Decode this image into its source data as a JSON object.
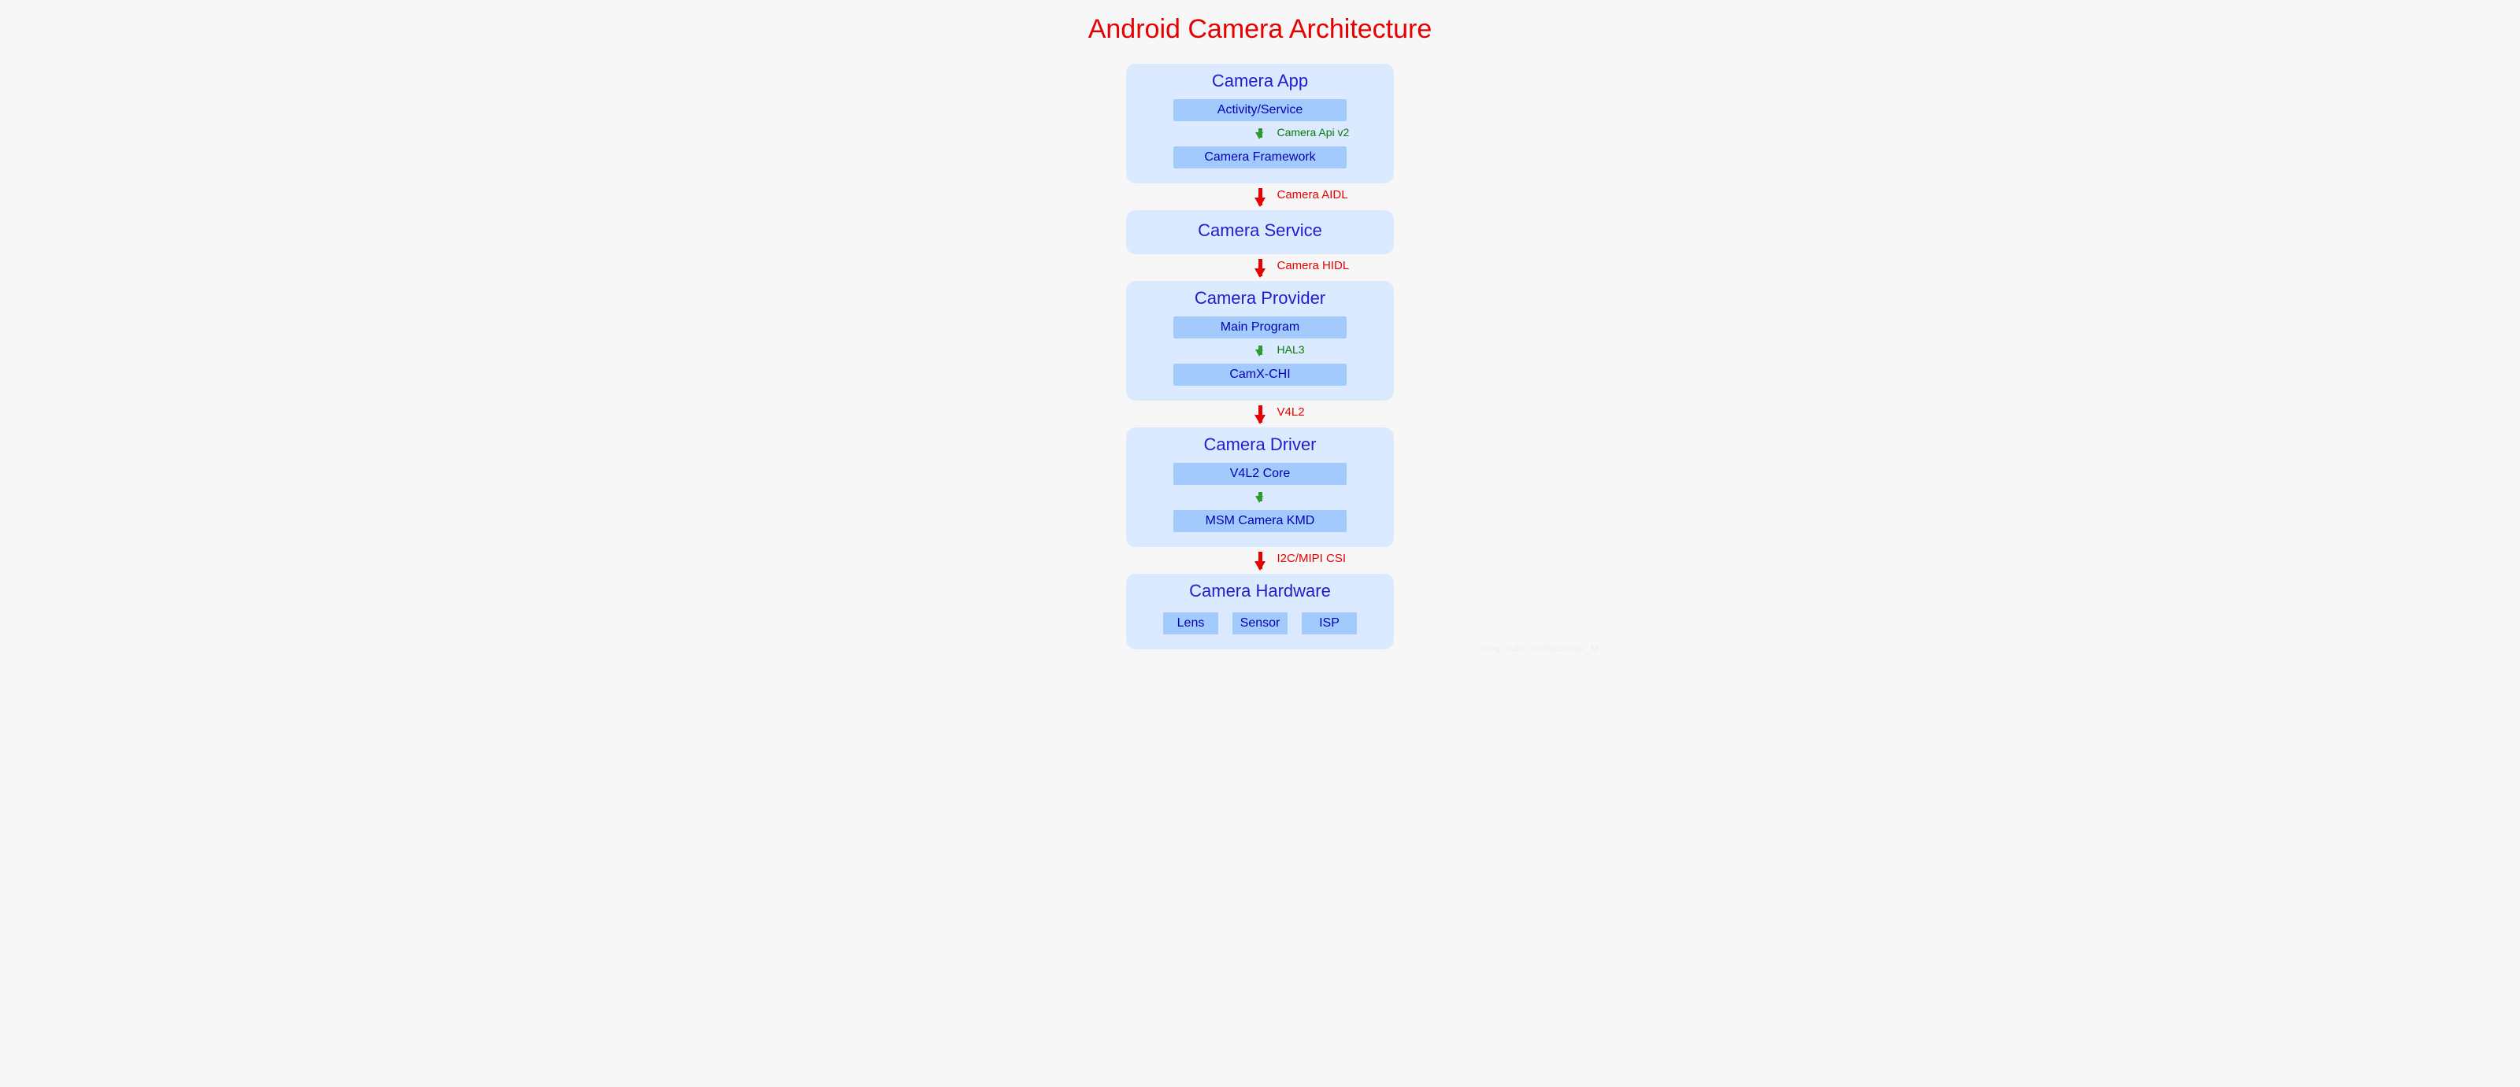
{
  "title": "Android Camera Architecture",
  "layers": [
    {
      "id": "app",
      "title": "Camera App",
      "children": [
        {
          "type": "box",
          "label": "Activity/Service"
        },
        {
          "type": "arrow",
          "color": "green",
          "label": "Camera Api v2"
        },
        {
          "type": "box",
          "label": "Camera Framework"
        }
      ]
    },
    {
      "type": "arrow",
      "color": "red",
      "label": "Camera AIDL"
    },
    {
      "id": "service",
      "title": "Camera Service",
      "children": []
    },
    {
      "type": "arrow",
      "color": "red",
      "label": "Camera HIDL"
    },
    {
      "id": "provider",
      "title": "Camera Provider",
      "children": [
        {
          "type": "box",
          "label": "Main Program"
        },
        {
          "type": "arrow",
          "color": "green",
          "label": "HAL3"
        },
        {
          "type": "box",
          "label": "CamX-CHI"
        }
      ]
    },
    {
      "type": "arrow",
      "color": "red",
      "label": "V4L2"
    },
    {
      "id": "driver",
      "title": "Camera Driver",
      "children": [
        {
          "type": "box",
          "label": "V4L2 Core"
        },
        {
          "type": "arrow",
          "color": "green",
          "label": ""
        },
        {
          "type": "box",
          "label": "MSM Camera KMD"
        }
      ]
    },
    {
      "type": "arrow",
      "color": "red",
      "label": "I2C/MIPI CSI"
    },
    {
      "id": "hardware",
      "title": "Camera Hardware",
      "children": [
        {
          "type": "row",
          "items": [
            "Lens",
            "Sensor",
            "ISP"
          ]
        }
      ]
    }
  ],
  "watermark": "blog.csdn.net/Nicholas_M"
}
